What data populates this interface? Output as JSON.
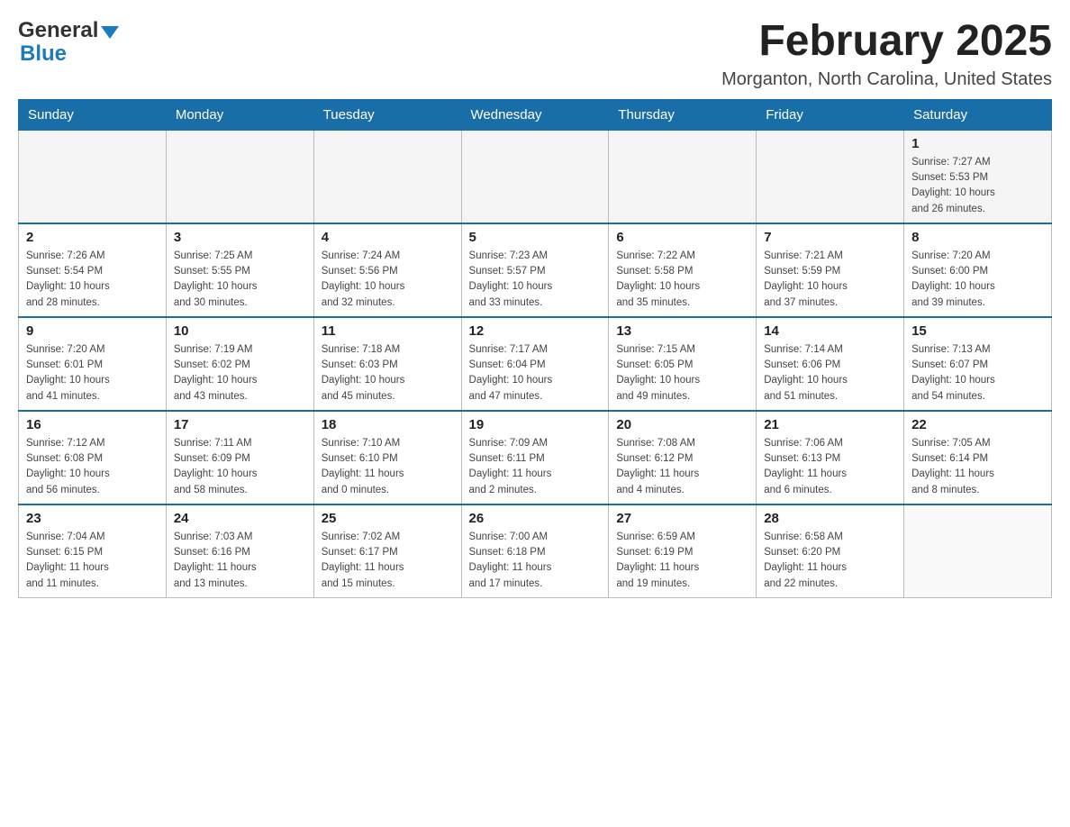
{
  "header": {
    "logo_general": "General",
    "logo_blue": "Blue",
    "title": "February 2025",
    "subtitle": "Morganton, North Carolina, United States"
  },
  "days_of_week": [
    "Sunday",
    "Monday",
    "Tuesday",
    "Wednesday",
    "Thursday",
    "Friday",
    "Saturday"
  ],
  "weeks": [
    {
      "days": [
        {
          "number": "",
          "info": ""
        },
        {
          "number": "",
          "info": ""
        },
        {
          "number": "",
          "info": ""
        },
        {
          "number": "",
          "info": ""
        },
        {
          "number": "",
          "info": ""
        },
        {
          "number": "",
          "info": ""
        },
        {
          "number": "1",
          "info": "Sunrise: 7:27 AM\nSunset: 5:53 PM\nDaylight: 10 hours\nand 26 minutes."
        }
      ]
    },
    {
      "days": [
        {
          "number": "2",
          "info": "Sunrise: 7:26 AM\nSunset: 5:54 PM\nDaylight: 10 hours\nand 28 minutes."
        },
        {
          "number": "3",
          "info": "Sunrise: 7:25 AM\nSunset: 5:55 PM\nDaylight: 10 hours\nand 30 minutes."
        },
        {
          "number": "4",
          "info": "Sunrise: 7:24 AM\nSunset: 5:56 PM\nDaylight: 10 hours\nand 32 minutes."
        },
        {
          "number": "5",
          "info": "Sunrise: 7:23 AM\nSunset: 5:57 PM\nDaylight: 10 hours\nand 33 minutes."
        },
        {
          "number": "6",
          "info": "Sunrise: 7:22 AM\nSunset: 5:58 PM\nDaylight: 10 hours\nand 35 minutes."
        },
        {
          "number": "7",
          "info": "Sunrise: 7:21 AM\nSunset: 5:59 PM\nDaylight: 10 hours\nand 37 minutes."
        },
        {
          "number": "8",
          "info": "Sunrise: 7:20 AM\nSunset: 6:00 PM\nDaylight: 10 hours\nand 39 minutes."
        }
      ]
    },
    {
      "days": [
        {
          "number": "9",
          "info": "Sunrise: 7:20 AM\nSunset: 6:01 PM\nDaylight: 10 hours\nand 41 minutes."
        },
        {
          "number": "10",
          "info": "Sunrise: 7:19 AM\nSunset: 6:02 PM\nDaylight: 10 hours\nand 43 minutes."
        },
        {
          "number": "11",
          "info": "Sunrise: 7:18 AM\nSunset: 6:03 PM\nDaylight: 10 hours\nand 45 minutes."
        },
        {
          "number": "12",
          "info": "Sunrise: 7:17 AM\nSunset: 6:04 PM\nDaylight: 10 hours\nand 47 minutes."
        },
        {
          "number": "13",
          "info": "Sunrise: 7:15 AM\nSunset: 6:05 PM\nDaylight: 10 hours\nand 49 minutes."
        },
        {
          "number": "14",
          "info": "Sunrise: 7:14 AM\nSunset: 6:06 PM\nDaylight: 10 hours\nand 51 minutes."
        },
        {
          "number": "15",
          "info": "Sunrise: 7:13 AM\nSunset: 6:07 PM\nDaylight: 10 hours\nand 54 minutes."
        }
      ]
    },
    {
      "days": [
        {
          "number": "16",
          "info": "Sunrise: 7:12 AM\nSunset: 6:08 PM\nDaylight: 10 hours\nand 56 minutes."
        },
        {
          "number": "17",
          "info": "Sunrise: 7:11 AM\nSunset: 6:09 PM\nDaylight: 10 hours\nand 58 minutes."
        },
        {
          "number": "18",
          "info": "Sunrise: 7:10 AM\nSunset: 6:10 PM\nDaylight: 11 hours\nand 0 minutes."
        },
        {
          "number": "19",
          "info": "Sunrise: 7:09 AM\nSunset: 6:11 PM\nDaylight: 11 hours\nand 2 minutes."
        },
        {
          "number": "20",
          "info": "Sunrise: 7:08 AM\nSunset: 6:12 PM\nDaylight: 11 hours\nand 4 minutes."
        },
        {
          "number": "21",
          "info": "Sunrise: 7:06 AM\nSunset: 6:13 PM\nDaylight: 11 hours\nand 6 minutes."
        },
        {
          "number": "22",
          "info": "Sunrise: 7:05 AM\nSunset: 6:14 PM\nDaylight: 11 hours\nand 8 minutes."
        }
      ]
    },
    {
      "days": [
        {
          "number": "23",
          "info": "Sunrise: 7:04 AM\nSunset: 6:15 PM\nDaylight: 11 hours\nand 11 minutes."
        },
        {
          "number": "24",
          "info": "Sunrise: 7:03 AM\nSunset: 6:16 PM\nDaylight: 11 hours\nand 13 minutes."
        },
        {
          "number": "25",
          "info": "Sunrise: 7:02 AM\nSunset: 6:17 PM\nDaylight: 11 hours\nand 15 minutes."
        },
        {
          "number": "26",
          "info": "Sunrise: 7:00 AM\nSunset: 6:18 PM\nDaylight: 11 hours\nand 17 minutes."
        },
        {
          "number": "27",
          "info": "Sunrise: 6:59 AM\nSunset: 6:19 PM\nDaylight: 11 hours\nand 19 minutes."
        },
        {
          "number": "28",
          "info": "Sunrise: 6:58 AM\nSunset: 6:20 PM\nDaylight: 11 hours\nand 22 minutes."
        },
        {
          "number": "",
          "info": ""
        }
      ]
    }
  ]
}
